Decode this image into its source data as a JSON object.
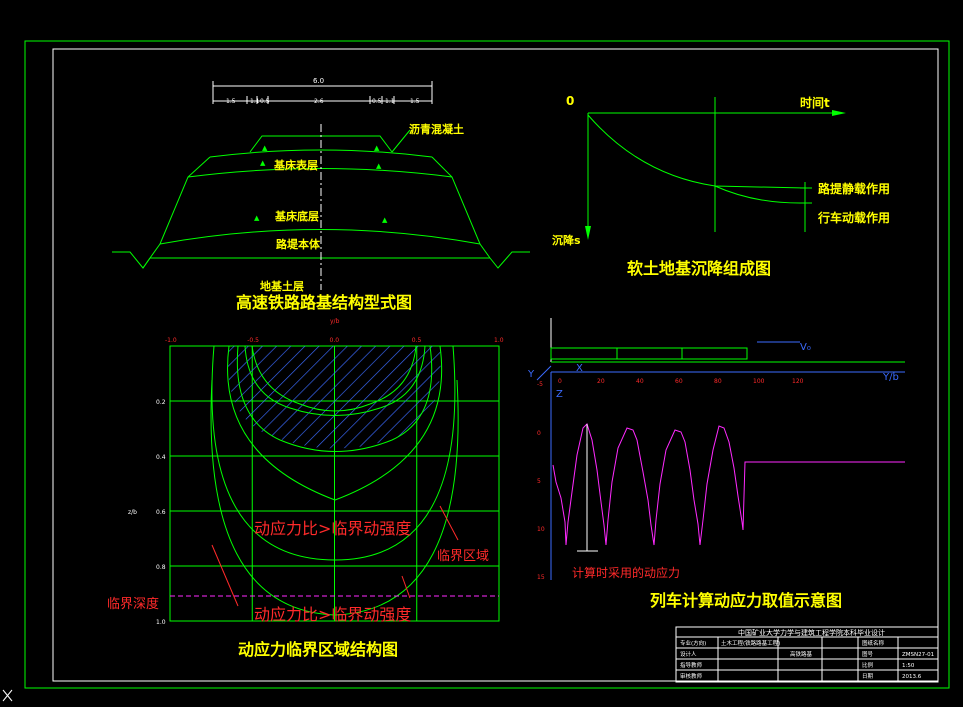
{
  "labels": {
    "embankment_title": "高速铁路路基结构型式图",
    "settlement_title": "软土地基沉降组成图",
    "critical_title": "动应力临界区域结构图",
    "train_title": "列车计算动应力取值示意图",
    "asphalt": "沥青混凝土",
    "base_surface": "基床表层",
    "base_bottom": "基床底层",
    "embankment_body": "路堤本体",
    "foundation": "地基土层",
    "time_axis": "时间t",
    "settle_axis": "沉降s",
    "origin": "0",
    "static_load": "路提静载作用",
    "train_load": "行车动载作用",
    "ratio_gt": "动应力比>临界动强度",
    "ratio_lt": "动应力比>临界动强度",
    "critical_zone": "临界区域",
    "critical_depth": "临界深度",
    "adopted_stress": "计算时采用的动应力",
    "axis_x": "X",
    "axis_y": "Y",
    "axis_z": "Z",
    "axis_yb": "Y/b",
    "axis_zb": "z/b",
    "v0": "V₀",
    "top_yb": "y/b",
    "dim_total": "6.0",
    "dim_1": "1.5",
    "dim_2": "1.1",
    "dim_3": "0.5",
    "dim_4": "2.6",
    "dim_5": "0.5",
    "dim_6": "1.1",
    "dim_7": "1.5"
  },
  "critical_chart": {
    "x_ticks": [
      "-1.0",
      "-0.5",
      "0.0",
      "0.5",
      "1.0"
    ],
    "y_ticks": [
      "0.2",
      "0.4",
      "0.6",
      "0.8",
      "1.0"
    ]
  },
  "train_chart": {
    "x_ticks": [
      "0",
      "20",
      "40",
      "60",
      "80",
      "100",
      "120"
    ],
    "y_ticks": [
      "-5",
      "0",
      "5",
      "10",
      "15"
    ]
  },
  "title_block": {
    "header": "中国矿业大学力学与建筑工程学院本科毕业设计",
    "rows": [
      [
        "专业(方向)",
        "土木工程(铁路路基工程)",
        "",
        "",
        "图纸名称",
        ""
      ],
      [
        "设计人",
        "",
        "",
        "",
        "图号",
        ""
      ],
      [
        "指导教师",
        "",
        "",
        "",
        "比例",
        ""
      ],
      [
        "审核教师",
        "",
        "",
        "",
        "日期",
        ""
      ]
    ],
    "cells": [
      "高铁路基",
      "ZMSN27-01",
      "1:50",
      "2013.6"
    ]
  },
  "colors": {
    "line": "#00ff00",
    "title": "#ffff00",
    "annotation": "#ff2a2a",
    "hatch": "#3b6bff",
    "stress": "#ff2aff"
  }
}
